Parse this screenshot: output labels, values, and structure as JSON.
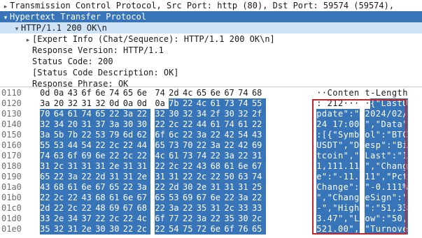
{
  "tree": [
    {
      "text": "Transmission Control Protocol, Src Port: http (80), Dst Port: 59574 (59574),",
      "arrow": "▸",
      "indent": 0,
      "state": "normal"
    },
    {
      "text": "Hypertext Transfer Protocol",
      "arrow": "▾",
      "indent": 0,
      "state": "selected"
    },
    {
      "text": "HTTP/1.1 200 OK\\n",
      "arrow": "▾",
      "indent": 1,
      "state": "highlight"
    },
    {
      "text": "[Expert Info (Chat/Sequence): HTTP/1.1 200 OK\\n]",
      "arrow": "▸",
      "indent": 2,
      "state": "normal"
    },
    {
      "text": "Response Version: HTTP/1.1",
      "arrow": "",
      "indent": 2,
      "state": "normal"
    },
    {
      "text": "Status Code: 200",
      "arrow": "",
      "indent": 2,
      "state": "normal"
    },
    {
      "text": "[Status Code Description: OK]",
      "arrow": "",
      "indent": 2,
      "state": "normal"
    },
    {
      "text": "Response Phrase: OK",
      "arrow": "",
      "indent": 2,
      "state": "normal"
    }
  ],
  "hex_rows": [
    {
      "offset": "0110",
      "bytes": [
        "0d",
        "0a",
        "43",
        "6f",
        "6e",
        "74",
        "65",
        "6e",
        "74",
        "2d",
        "4c",
        "65",
        "6e",
        "67",
        "74",
        "68"
      ],
      "ascii": "··Conten t-Length",
      "sel_from": 16
    },
    {
      "offset": "0120",
      "bytes": [
        "3a",
        "20",
        "32",
        "31",
        "32",
        "0d",
        "0a",
        "0d",
        "0a",
        "7b",
        "22",
        "4c",
        "61",
        "73",
        "74",
        "55"
      ],
      "ascii": ": 212··· ·{\"LastU",
      "sel_from": 9
    },
    {
      "offset": "0130",
      "bytes": [
        "70",
        "64",
        "61",
        "74",
        "65",
        "22",
        "3a",
        "22",
        "32",
        "30",
        "32",
        "34",
        "2f",
        "30",
        "32",
        "2f"
      ],
      "ascii": "pdate\":\" 2024/02/",
      "sel_from": 0
    },
    {
      "offset": "0140",
      "bytes": [
        "32",
        "34",
        "20",
        "31",
        "37",
        "3a",
        "30",
        "30",
        "22",
        "2c",
        "22",
        "44",
        "61",
        "74",
        "61",
        "22"
      ],
      "ascii": "24 17:00 \",\"Data\"",
      "sel_from": 0
    },
    {
      "offset": "0150",
      "bytes": [
        "3a",
        "5b",
        "7b",
        "22",
        "53",
        "79",
        "6d",
        "62",
        "6f",
        "6c",
        "22",
        "3a",
        "22",
        "42",
        "54",
        "43"
      ],
      "ascii": ":[{\"Symb ol\":\"BTC",
      "sel_from": 0
    },
    {
      "offset": "0160",
      "bytes": [
        "55",
        "53",
        "44",
        "54",
        "22",
        "2c",
        "22",
        "44",
        "65",
        "73",
        "70",
        "22",
        "3a",
        "22",
        "42",
        "69"
      ],
      "ascii": "USDT\",\"D esp\":\"Bi",
      "sel_from": 0
    },
    {
      "offset": "0170",
      "bytes": [
        "74",
        "63",
        "6f",
        "69",
        "6e",
        "22",
        "2c",
        "22",
        "4c",
        "61",
        "73",
        "74",
        "22",
        "3a",
        "22",
        "31"
      ],
      "ascii": "tcoin\",\" Last\":\"1",
      "sel_from": 0
    },
    {
      "offset": "0180",
      "bytes": [
        "31",
        "2c",
        "31",
        "31",
        "31",
        "2e",
        "31",
        "31",
        "22",
        "2c",
        "22",
        "43",
        "68",
        "61",
        "6e",
        "67"
      ],
      "ascii": "1,111.11 \",\"Chang",
      "sel_from": 0
    },
    {
      "offset": "0190",
      "bytes": [
        "65",
        "22",
        "3a",
        "22",
        "2d",
        "31",
        "31",
        "2e",
        "31",
        "31",
        "22",
        "2c",
        "22",
        "50",
        "63",
        "74"
      ],
      "ascii": "e\":\"-11. 11\",\"Pct",
      "sel_from": 0
    },
    {
      "offset": "01a0",
      "bytes": [
        "43",
        "68",
        "61",
        "6e",
        "67",
        "65",
        "22",
        "3a",
        "22",
        "2d",
        "30",
        "2e",
        "31",
        "31",
        "31",
        "25"
      ],
      "ascii": "Change\": \"-0.111%",
      "sel_from": 0
    },
    {
      "offset": "01b0",
      "bytes": [
        "22",
        "2c",
        "22",
        "43",
        "68",
        "61",
        "6e",
        "67",
        "65",
        "53",
        "69",
        "67",
        "6e",
        "22",
        "3a",
        "22"
      ],
      "ascii": "\",\"Chang eSign\":\"",
      "sel_from": 0
    },
    {
      "offset": "01c0",
      "bytes": [
        "2d",
        "22",
        "2c",
        "22",
        "48",
        "69",
        "67",
        "68",
        "22",
        "3a",
        "22",
        "35",
        "31",
        "2c",
        "33",
        "33"
      ],
      "ascii": "-\",\"High \":\"51,33",
      "sel_from": 0
    },
    {
      "offset": "01d0",
      "bytes": [
        "33",
        "2e",
        "34",
        "37",
        "22",
        "2c",
        "22",
        "4c",
        "6f",
        "77",
        "22",
        "3a",
        "22",
        "35",
        "30",
        "2c"
      ],
      "ascii": "3.47\",\"L ow\":\"50,",
      "sel_from": 0
    },
    {
      "offset": "01e0",
      "bytes": [
        "35",
        "32",
        "31",
        "2e",
        "30",
        "30",
        "22",
        "2c",
        "22",
        "54",
        "75",
        "72",
        "6e",
        "6f",
        "76",
        "65"
      ],
      "ascii": "521.00\", \"Turnove",
      "sel_from": 0
    }
  ],
  "colors": {
    "selection": "#3874b8",
    "highlight": "#cfe3f7",
    "annotation_box": "#c0262d"
  }
}
